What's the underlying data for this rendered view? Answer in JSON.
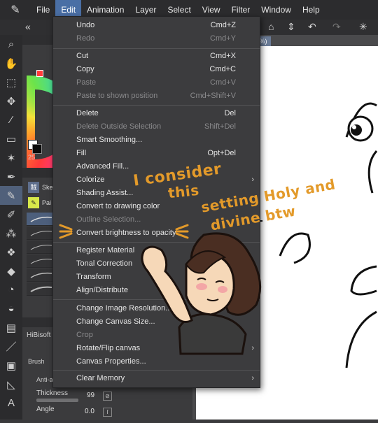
{
  "menubar": {
    "items": [
      "File",
      "Edit",
      "Animation",
      "Layer",
      "Select",
      "View",
      "Filter",
      "Window",
      "Help"
    ]
  },
  "doc_tab": "%)",
  "edit_menu": {
    "items": [
      {
        "label": "Undo",
        "shortcut": "Cmd+Z"
      },
      {
        "label": "Redo",
        "shortcut": "Cmd+Y"
      },
      {
        "label": "Cut",
        "shortcut": "Cmd+X"
      },
      {
        "label": "Copy",
        "shortcut": "Cmd+C"
      },
      {
        "label": "Paste",
        "shortcut": "Cmd+V"
      },
      {
        "label": "Paste to shown position",
        "shortcut": "Cmd+Shift+V"
      },
      {
        "label": "Delete",
        "shortcut": "Del"
      },
      {
        "label": "Delete Outside Selection",
        "shortcut": "Shift+Del"
      },
      {
        "label": "Smart Smoothing...",
        "shortcut": ""
      },
      {
        "label": "Fill",
        "shortcut": "Opt+Del"
      },
      {
        "label": "Advanced Fill...",
        "shortcut": ""
      },
      {
        "label": "Colorize",
        "shortcut": ""
      },
      {
        "label": "Shading Assist...",
        "shortcut": ""
      },
      {
        "label": "Convert to drawing color",
        "shortcut": ""
      },
      {
        "label": "Outline Selection...",
        "shortcut": ""
      },
      {
        "label": "Convert brightness to opacity",
        "shortcut": ""
      },
      {
        "label": "Register Material",
        "shortcut": ""
      },
      {
        "label": "Tonal Correction",
        "shortcut": ""
      },
      {
        "label": "Transform",
        "shortcut": ""
      },
      {
        "label": "Align/Distribute",
        "shortcut": ""
      },
      {
        "label": "Change Image Resolution...",
        "shortcut": ""
      },
      {
        "label": "Change Canvas Size...",
        "shortcut": ""
      },
      {
        "label": "Crop",
        "shortcut": ""
      },
      {
        "label": "Rotate/Flip canvas",
        "shortcut": ""
      },
      {
        "label": "Canvas Properties...",
        "shortcut": ""
      },
      {
        "label": "Clear Memory",
        "shortcut": ""
      }
    ]
  },
  "sub_tools": [
    {
      "badge": "賊",
      "label": "Ske"
    },
    {
      "badge": "✎",
      "label": "Pai"
    }
  ],
  "panel_number": "25",
  "tool_property": {
    "title": "HiBisoft",
    "brush_label": "Brush",
    "antialias_label": "Anti-ali",
    "thickness_label": "Thickness",
    "thickness_value": "99",
    "angle_label": "Angle",
    "angle_value": "0.0"
  },
  "overlay": {
    "line1": "I consider",
    "line2": "this",
    "line3": "setting Holy and",
    "line4": "divine btw"
  },
  "colors": {
    "menu_bg": "#3c3c3e",
    "menubar_bg": "#2c2c2e",
    "accent": "#4a6fa5",
    "annotation": "#e39a2a",
    "disabled_text": "#8a8a8c"
  }
}
